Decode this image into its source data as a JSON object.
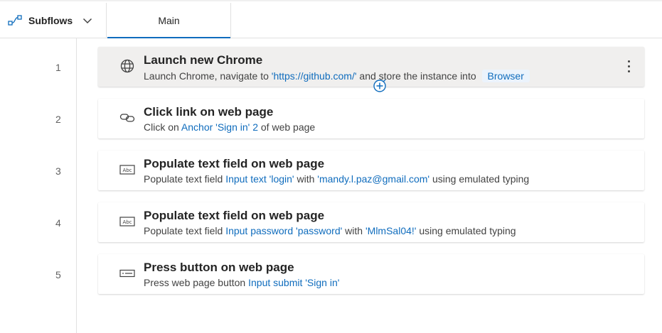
{
  "header": {
    "subflows_label": "Subflows",
    "main_tab_label": "Main"
  },
  "colors": {
    "accent": "#0f6cbd",
    "selected_row_bg": "#f0efee",
    "variable_chip_bg": "#ebf3fc"
  },
  "steps": [
    {
      "number": "1",
      "icon": "globe-icon",
      "title": "Launch new Chrome",
      "desc_prefix": "Launch Chrome, navigate to ",
      "desc_link": "'https://github.com/'",
      "desc_middle": " and store the instance into ",
      "desc_variable": "Browser",
      "selected": true
    },
    {
      "number": "2",
      "icon": "link-icon",
      "title": "Click link on web page",
      "desc_prefix": "Click on ",
      "desc_link": "Anchor 'Sign in' 2",
      "desc_suffix": " of web page"
    },
    {
      "number": "3",
      "icon": "text-field-icon",
      "title": "Populate text field on web page",
      "desc_prefix": "Populate text field ",
      "desc_link": "Input text 'login'",
      "desc_middle": " with ",
      "desc_link2": "'mandy.l.paz@gmail.com'",
      "desc_suffix": " using emulated typing"
    },
    {
      "number": "4",
      "icon": "text-field-icon",
      "title": "Populate text field on web page",
      "desc_prefix": "Populate text field ",
      "desc_link": "Input password 'password'",
      "desc_middle": " with ",
      "desc_link2": "'MlmSal04!'",
      "desc_suffix": " using emulated typing"
    },
    {
      "number": "5",
      "icon": "button-icon",
      "title": "Press button on web page",
      "desc_prefix": "Press web page button ",
      "desc_link": "Input submit 'Sign in'"
    }
  ]
}
